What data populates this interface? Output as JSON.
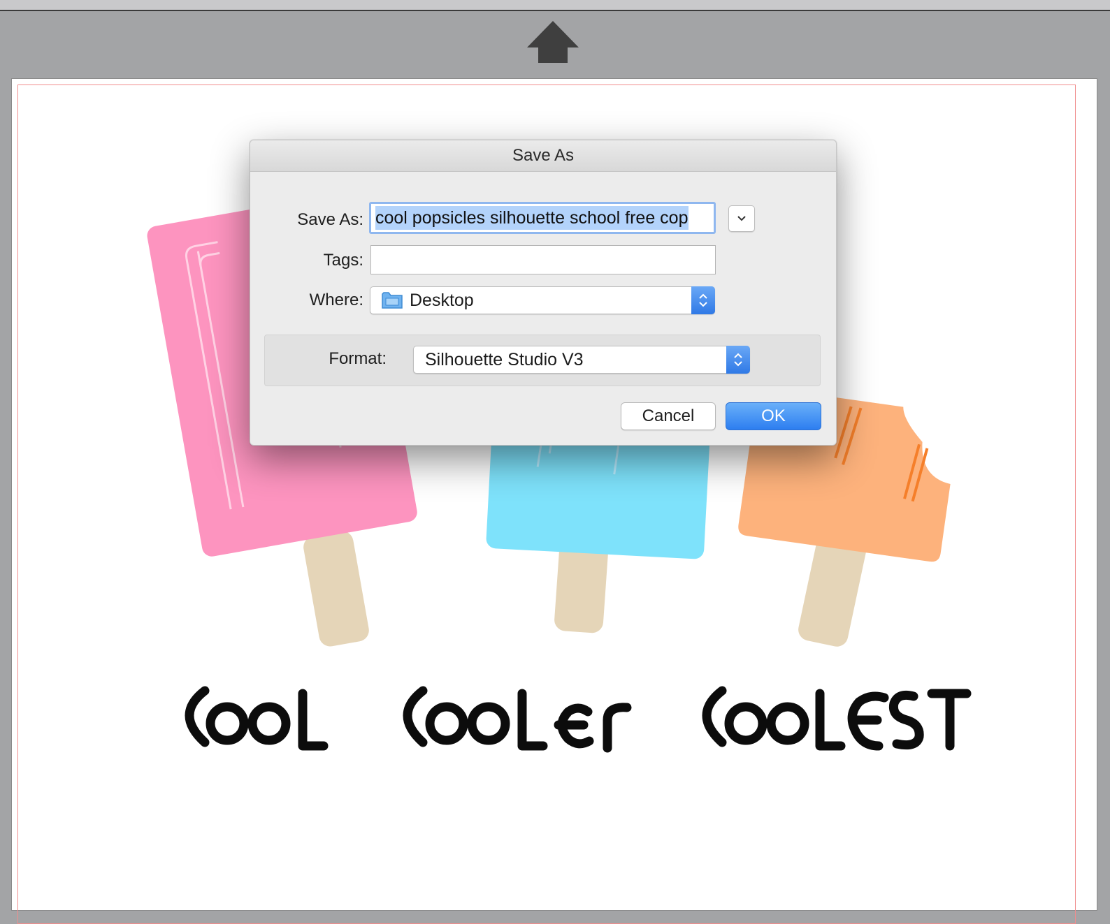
{
  "dialog": {
    "title": "Save As",
    "save_as_label": "Save As:",
    "save_as_value": "cool popsicles silhouette school free cop",
    "tags_label": "Tags:",
    "tags_value": "",
    "where_label": "Where:",
    "where_value": "Desktop",
    "format_label": "Format:",
    "format_value": "Silhouette Studio V3",
    "cancel_label": "Cancel",
    "ok_label": "OK"
  },
  "canvas": {
    "artwork_text": [
      "COOL",
      "COOLER",
      "COOLEST"
    ],
    "popsicle_colors": {
      "pink": "#fd94bf",
      "blue": "#7ee2fb",
      "orange": "#fdb27c",
      "stick": "#e5d5b8"
    }
  },
  "colors": {
    "accent": "#2f79e6",
    "cut_line": "#f08d8d"
  },
  "icons": {
    "up": "up-arrow-icon",
    "folder": "folder-icon",
    "expand": "chevron-down-icon",
    "stepper": "up-down-stepper-icon"
  }
}
